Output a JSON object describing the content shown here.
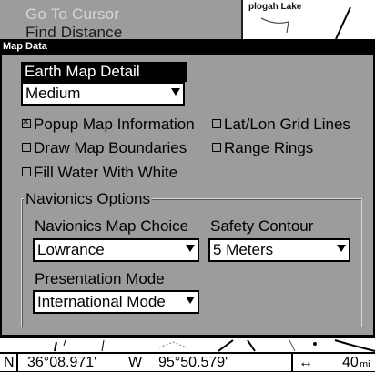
{
  "background_menu": {
    "items": [
      "Go To Cursor",
      "Find Distance"
    ],
    "map_label": "plogah Lake"
  },
  "dialog": {
    "title": "Map Data",
    "earth_map_detail": {
      "header": "Earth Map Detail",
      "selected": "Medium"
    },
    "checkboxes": {
      "popup_map_information": {
        "label": "Popup Map Information",
        "checked": true
      },
      "lat_lon_grid_lines": {
        "label": "Lat/Lon Grid Lines",
        "checked": false
      },
      "draw_map_boundaries": {
        "label": "Draw Map Boundaries",
        "checked": false
      },
      "range_rings": {
        "label": "Range Rings",
        "checked": false
      },
      "fill_water_with_white": {
        "label": "Fill Water With White",
        "checked": false
      }
    },
    "navionics": {
      "group_title": "Navionics Options",
      "map_choice_label": "Navionics Map Choice",
      "map_choice_selected": "Lowrance",
      "safety_contour_label": "Safety Contour",
      "safety_contour_selected": "5 Meters",
      "presentation_mode_label": "Presentation Mode",
      "presentation_mode_selected": "International Mode"
    }
  },
  "status_bar": {
    "lat_hemisphere": "N",
    "latitude": "36°08.971'",
    "lon_hemisphere": "W",
    "longitude": "95°50.579'",
    "range_icon": "↔",
    "range_value": "40",
    "range_unit": "mi"
  }
}
